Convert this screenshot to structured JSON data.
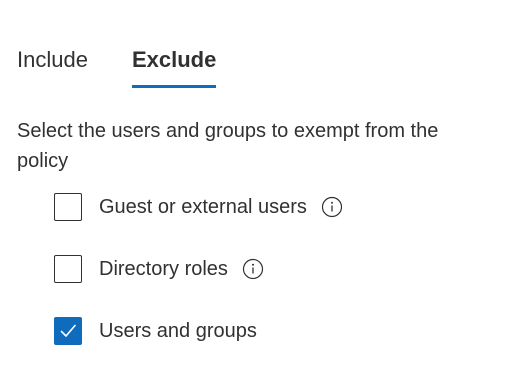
{
  "tabs": [
    {
      "label": "Include",
      "selected": false
    },
    {
      "label": "Exclude",
      "selected": true
    }
  ],
  "description": "Select the users and groups to exempt from the policy",
  "options": [
    {
      "label": "Guest or external users",
      "checked": false,
      "info_icon": "info-icon"
    },
    {
      "label": "Directory roles",
      "checked": false,
      "info_icon": "info-icon"
    },
    {
      "label": "Users and groups",
      "checked": true
    }
  ],
  "colors": {
    "accent": "#0f6cbd",
    "text": "#323130"
  }
}
